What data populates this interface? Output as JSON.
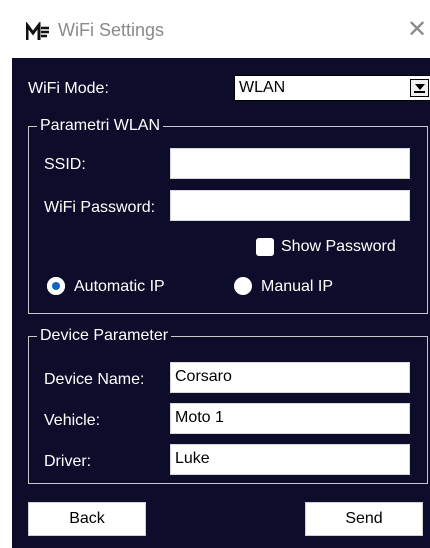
{
  "window": {
    "title": "WiFi Settings",
    "close_glyph": "✕",
    "app_icon": "logo-icon"
  },
  "wifi_mode": {
    "label": "WiFi Mode:",
    "selected": "WLAN"
  },
  "wlan_group": {
    "title": "Parametri WLAN",
    "ssid_label": "SSID:",
    "ssid_value": "",
    "password_label": "WiFi Password:",
    "password_value": "",
    "show_password_label": "Show Password",
    "show_password_checked": false,
    "automatic_ip_label": "Automatic IP",
    "manual_ip_label": "Manual IP",
    "ip_mode_selected": "Automatic IP"
  },
  "device_group": {
    "title": "Device Parameter",
    "device_name_label": "Device Name:",
    "device_name_value": "Corsaro",
    "vehicle_label": "Vehicle:",
    "vehicle_value": "Moto 1",
    "driver_label": "Driver:",
    "driver_value": "Luke"
  },
  "buttons": {
    "back": "Back",
    "send": "Send"
  },
  "colors": {
    "background": "#0d0d2b",
    "radio_accent": "#1565c0"
  }
}
